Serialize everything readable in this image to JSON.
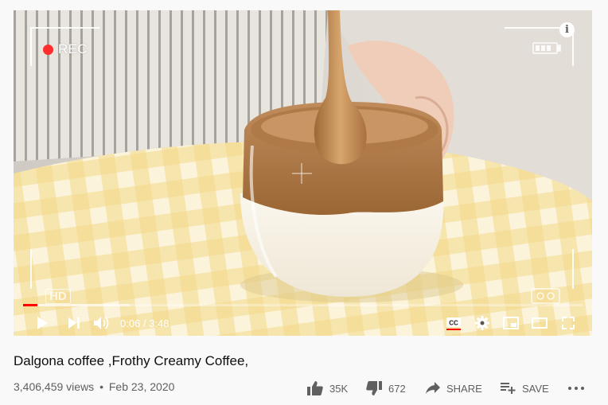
{
  "video": {
    "rec_label": "REC",
    "hd_label": "HD",
    "current_time": "0:06",
    "duration": "3:48",
    "played_fraction": 0.026,
    "loaded_fraction": 0.19,
    "accent_color": "#ff0000"
  },
  "controls": {
    "icons": [
      "play-icon",
      "next-icon",
      "volume-icon",
      "captions-icon",
      "settings-icon",
      "miniplayer-icon",
      "theater-icon",
      "fullscreen-icon"
    ]
  },
  "title": "Dalgona coffee ,Frothy Creamy Coffee,",
  "meta": {
    "views": "3,406,459 views",
    "separator": "•",
    "date": "Feb 23, 2020"
  },
  "actions": {
    "like_count": "35K",
    "dislike_count": "672",
    "share_label": "SHARE",
    "save_label": "SAVE"
  }
}
